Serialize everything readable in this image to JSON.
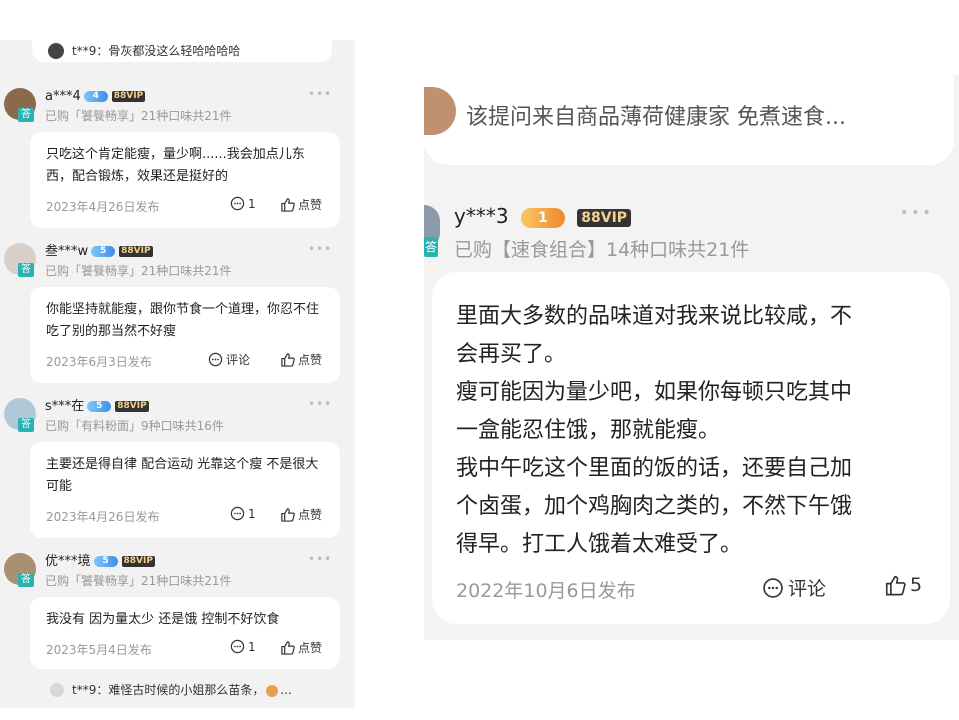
{
  "left": {
    "top_reply": {
      "user": "t**9：",
      "text": "骨灰都没这么轻哈哈哈哈"
    },
    "answers": [
      {
        "user": "a***4",
        "level": "4",
        "vip": "88VIP",
        "bought": "已购「饕餮畅享」21种口味共21件",
        "badge": "答",
        "text": "只吃这个肯定能瘦，量少啊......我会加点儿东西，配合锻炼，效果还是挺好的",
        "date": "2023年4月26日发布",
        "comment": "1",
        "like": "点赞"
      },
      {
        "user": "叁***w",
        "level": "5",
        "vip": "88VIP",
        "bought": "已购「饕餮畅享」21种口味共21件",
        "badge": "答",
        "text": "你能坚持就能瘦，跟你节食一个道理，你忍不住吃了别的那当然不好瘦",
        "date": "2023年6月3日发布",
        "comment": "评论",
        "like": "点赞"
      },
      {
        "user": "s***在",
        "level": "5",
        "vip": "88VIP",
        "bought": "已购「有料粉面」9种口味共16件",
        "badge": "答",
        "text": "主要还是得自律 配合运动 光靠这个瘦 不是很大可能",
        "date": "2023年4月26日发布",
        "comment": "1",
        "like": "点赞"
      },
      {
        "user": "优***境",
        "level": "5",
        "vip": "88VIP",
        "bought": "已购「饕餮畅享」21种口味共21件",
        "badge": "答",
        "text": "我没有 因为量太少 还是饿 控制不好饮食",
        "date": "2023年5月4日发布",
        "comment": "1",
        "like": "点赞"
      }
    ],
    "bottom_reply": {
      "user": "t**9：",
      "text": "难怪古时候的小姐那么苗条，"
    }
  },
  "right": {
    "question": "该提问来自商品薄荷健康家 免煮速食...",
    "answer": {
      "user": "y***3",
      "level": "1",
      "vip": "88VIP",
      "bought": "已购【速食组合】14种口味共21件",
      "badge": "答",
      "lines": [
        "里面大多数的品味道对我来说比较咸，不",
        "会再买了。",
        "瘦可能因为量少吧，如果你每顿只吃其中",
        "一盒能忍住饿，那就能瘦。",
        "我中午吃这个里面的饭的话，还要自己加",
        "个卤蛋，加个鸡胸肉之类的，不然下午饿",
        "得早。打工人饿着太难受了。"
      ],
      "date": "2022年10月6日发布",
      "comment": "评论",
      "like": "5"
    }
  },
  "colors": {
    "answer_badge": "#27b3b1",
    "vip_bg": "#333333",
    "vip_text": "#f5d08a"
  },
  "icons": {
    "comment": "comment-bubble-icon",
    "like": "thumbs-up-icon",
    "more": "more-dots-icon"
  }
}
